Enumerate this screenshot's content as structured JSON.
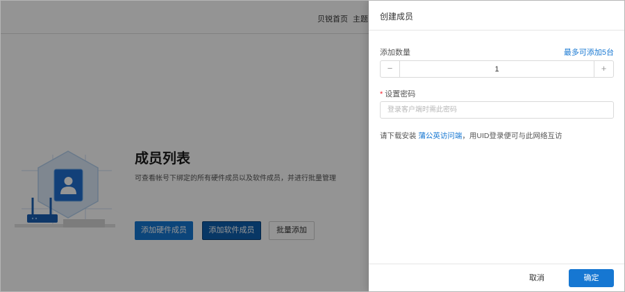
{
  "nav": {
    "home": "贝锐首页",
    "theme": "主题"
  },
  "page": {
    "title": "成员列表",
    "subtitle": "可查看帐号下绑定的所有硬件成员以及软件成员，并进行批量管理",
    "buttons": {
      "add_hardware": "添加硬件成员",
      "add_software": "添加软件成员",
      "batch_add": "批量添加"
    },
    "illustration_icons": [
      "hexagon-shape",
      "user-icon",
      "router-icon"
    ]
  },
  "drawer": {
    "title": "创建成员",
    "quantity": {
      "label": "添加数量",
      "limit_text": "最多可添加5台",
      "minus": "−",
      "plus": "+",
      "value": "1"
    },
    "password": {
      "required_mark": "*",
      "label": "设置密码",
      "placeholder": "登录客户端时需此密码",
      "value": ""
    },
    "help": {
      "prefix": "请下载安装 ",
      "link": "蒲公英访问端",
      "suffix": "，用UID登录便可与此网络互访"
    },
    "footer": {
      "cancel": "取消",
      "confirm": "确定"
    }
  },
  "colors": {
    "accent": "#1677d2",
    "required": "#f5222d",
    "overlay": "rgba(0,0,0,0.42)"
  }
}
